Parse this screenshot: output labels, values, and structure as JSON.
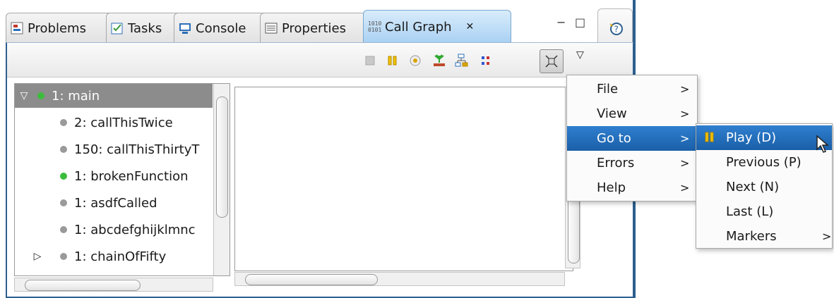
{
  "tabs": [
    {
      "label": "Problems",
      "icon": "problems-icon"
    },
    {
      "label": "Tasks",
      "icon": "tasks-icon"
    },
    {
      "label": "Console",
      "icon": "console-icon"
    },
    {
      "label": "Properties",
      "icon": "properties-icon"
    },
    {
      "label": "Call Graph",
      "icon": "call-graph-icon",
      "active": true,
      "close": "✕"
    }
  ],
  "window_controls": {
    "minimize": "−",
    "maximize": "□"
  },
  "toolbar": {
    "buttons": [
      "stop-icon",
      "pause-icon",
      "target-icon",
      "tree-view-icon",
      "hierarchy-icon",
      "matrix-icon",
      "collapse-icon"
    ],
    "view_menu": "▽"
  },
  "tree": {
    "items": [
      {
        "label": "1: main",
        "expander": "▽",
        "dot": "#3cbc3c",
        "selected": true
      },
      {
        "label": "2: callThisTwice",
        "dot": "#9a9a9a"
      },
      {
        "label": "150: callThisThirtyT",
        "dot": "#9a9a9a"
      },
      {
        "label": "1: brokenFunction",
        "dot": "#3cbc3c"
      },
      {
        "label": "1: asdfCalled",
        "dot": "#9a9a9a"
      },
      {
        "label": "1: abcdefghijklmnc",
        "dot": "#9a9a9a"
      },
      {
        "label": "1: chainOfFifty",
        "expander": "▷",
        "dot": "#9a9a9a"
      }
    ]
  },
  "context_menu": {
    "items": [
      {
        "label": "File",
        "arrow": ">"
      },
      {
        "label": "View",
        "arrow": ">"
      },
      {
        "label": "Go to",
        "arrow": ">",
        "selected": true
      },
      {
        "label": "Errors",
        "arrow": ">"
      },
      {
        "label": "Help",
        "arrow": ">"
      }
    ]
  },
  "submenu": {
    "items": [
      {
        "label": "Play (D)",
        "icon": "pause-icon",
        "selected": true
      },
      {
        "label": "Previous (P)"
      },
      {
        "label": "Next (N)"
      },
      {
        "label": "Last (L)"
      },
      {
        "label": "Markers",
        "arrow": ">"
      }
    ]
  },
  "colors": {
    "accent": "#1a5fa8",
    "frame": "#2c5f8f",
    "selection": "#8c8c8c"
  }
}
